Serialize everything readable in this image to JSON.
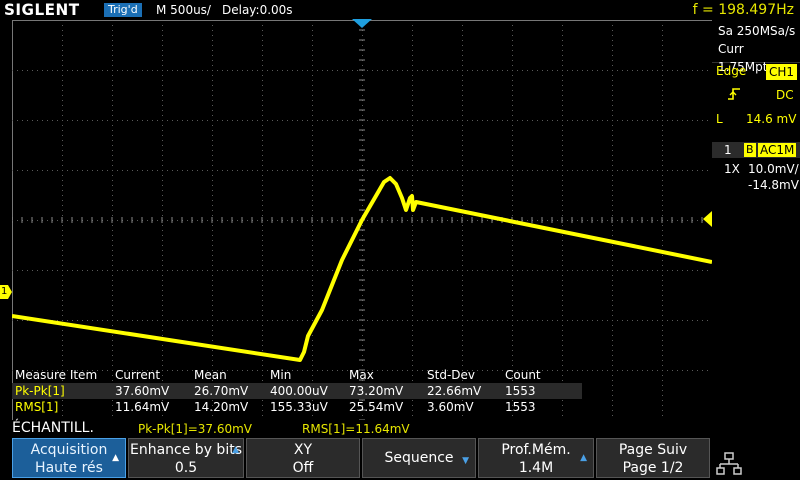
{
  "topbar": {
    "logo": "SIGLENT",
    "trigger_status": "Trig'd",
    "timebase": "M 500us/",
    "delay": "Delay:0.00s",
    "frequency": "f = 198.497Hz"
  },
  "acquisition_panel": {
    "sample_rate": "Sa 250MSa/s",
    "memory": "Curr 1.75Mpts"
  },
  "trigger_panel": {
    "type": "Edge",
    "source": "CH1",
    "coupling": "DC",
    "level_label": "L",
    "level": "14.6 mV"
  },
  "channel_panel": {
    "number": "1",
    "bandwidth_flag": "B",
    "coupling": "AC1M",
    "probe": "1X",
    "scale": "10.0mV/",
    "offset": "-14.8mV"
  },
  "markers": {
    "channel1_marker": "1"
  },
  "measure_table": {
    "headers": [
      "Measure Item",
      "Current",
      "Mean",
      "Min",
      "Max",
      "Std-Dev",
      "Count"
    ],
    "rows": [
      [
        "Pk-Pk[1]",
        "37.60mV",
        "26.70mV",
        "400.00uV",
        "73.20mV",
        "22.66mV",
        "1553"
      ],
      [
        "RMS[1]",
        "11.64mV",
        "14.20mV",
        "155.33uV",
        "25.54mV",
        "3.60mV",
        "1553"
      ]
    ]
  },
  "status": {
    "menu_title": "ÉCHANTILL.",
    "pkpk": "Pk-Pk[1]=37.60mV",
    "rms": "RMS[1]=11.64mV"
  },
  "softkeys": [
    {
      "line1": "Acquisition",
      "line2": "Haute rés"
    },
    {
      "line1": "Enhance by bits",
      "line2": "0.5"
    },
    {
      "line1": "XY",
      "line2": "Off"
    },
    {
      "line1": "Sequence",
      "line2": ""
    },
    {
      "line1": "Prof.Mém.",
      "line2": "1.4M"
    },
    {
      "line1": "Page Suiv",
      "line2": "Page 1/2"
    }
  ],
  "colors": {
    "trace": "#ffff00",
    "grid": "#5a5a5a",
    "accent": "#1c5f9a",
    "marker_blue": "#1f9fdf"
  }
}
